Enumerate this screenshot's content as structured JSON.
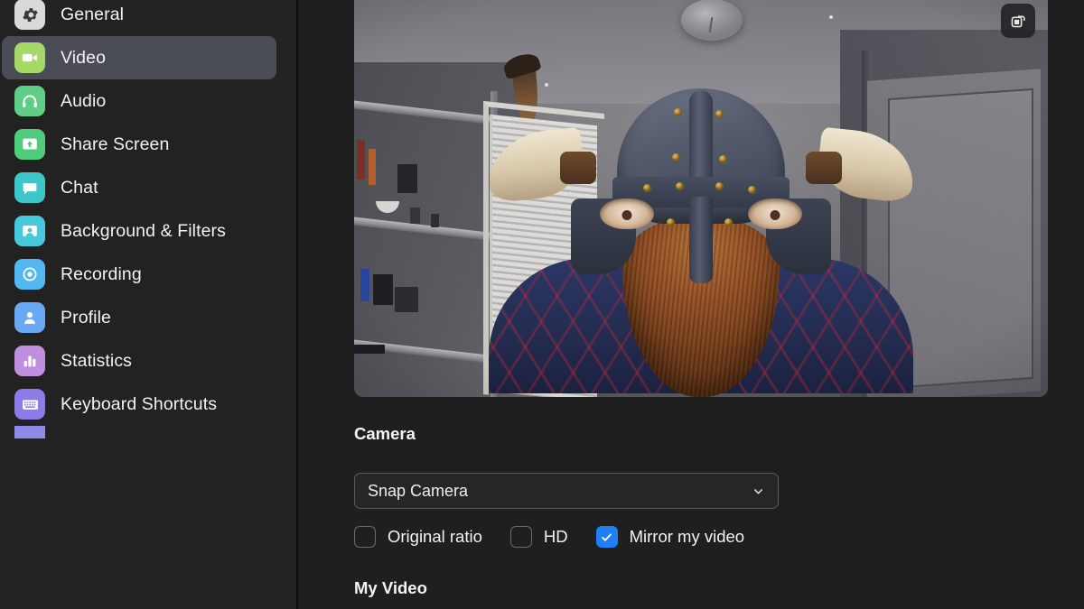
{
  "app": {
    "window_kind": "settings",
    "accent_color": "#1f7ff5",
    "selected_panel": "Video"
  },
  "sidebar": {
    "items": [
      {
        "label": "General",
        "icon": "gear-icon",
        "icon_color": "#d9d9d9",
        "selected": false
      },
      {
        "label": "Video",
        "icon": "video-camera-icon",
        "icon_color": "#a4d867",
        "selected": true
      },
      {
        "label": "Audio",
        "icon": "headphones-icon",
        "icon_color": "#5fce86",
        "selected": false
      },
      {
        "label": "Share Screen",
        "icon": "share-screen-icon",
        "icon_color": "#4fcd7d",
        "selected": false
      },
      {
        "label": "Chat",
        "icon": "chat-bubble-icon",
        "icon_color": "#3cc6c8",
        "selected": false
      },
      {
        "label": "Background & Filters",
        "icon": "background-filters-icon",
        "icon_color": "#46c8dd",
        "selected": false
      },
      {
        "label": "Recording",
        "icon": "recording-icon",
        "icon_color": "#53b8f0",
        "selected": false
      },
      {
        "label": "Profile",
        "icon": "profile-person-icon",
        "icon_color": "#69a8f2",
        "selected": false
      },
      {
        "label": "Statistics",
        "icon": "statistics-bars-icon",
        "icon_color": "#c18fe0",
        "selected": false
      },
      {
        "label": "Keyboard Shortcuts",
        "icon": "keyboard-icon",
        "icon_color": "#8a7de8",
        "selected": false
      },
      {
        "label": "",
        "icon": "clipped-icon",
        "icon_color": "#8e8ae6",
        "selected": false
      }
    ]
  },
  "main": {
    "video_preview": {
      "rotate_button_icon": "rotate-camera-icon",
      "scene_description": "Self view with Viking helmet filter"
    },
    "camera_section": {
      "title": "Camera",
      "select": {
        "value": "Snap Camera",
        "chevron_icon": "chevron-down-icon"
      },
      "checkboxes": [
        {
          "label": "Original ratio",
          "checked": false
        },
        {
          "label": "HD",
          "checked": false
        },
        {
          "label": "Mirror my video",
          "checked": true
        }
      ]
    },
    "my_video_section": {
      "title": "My Video"
    }
  }
}
